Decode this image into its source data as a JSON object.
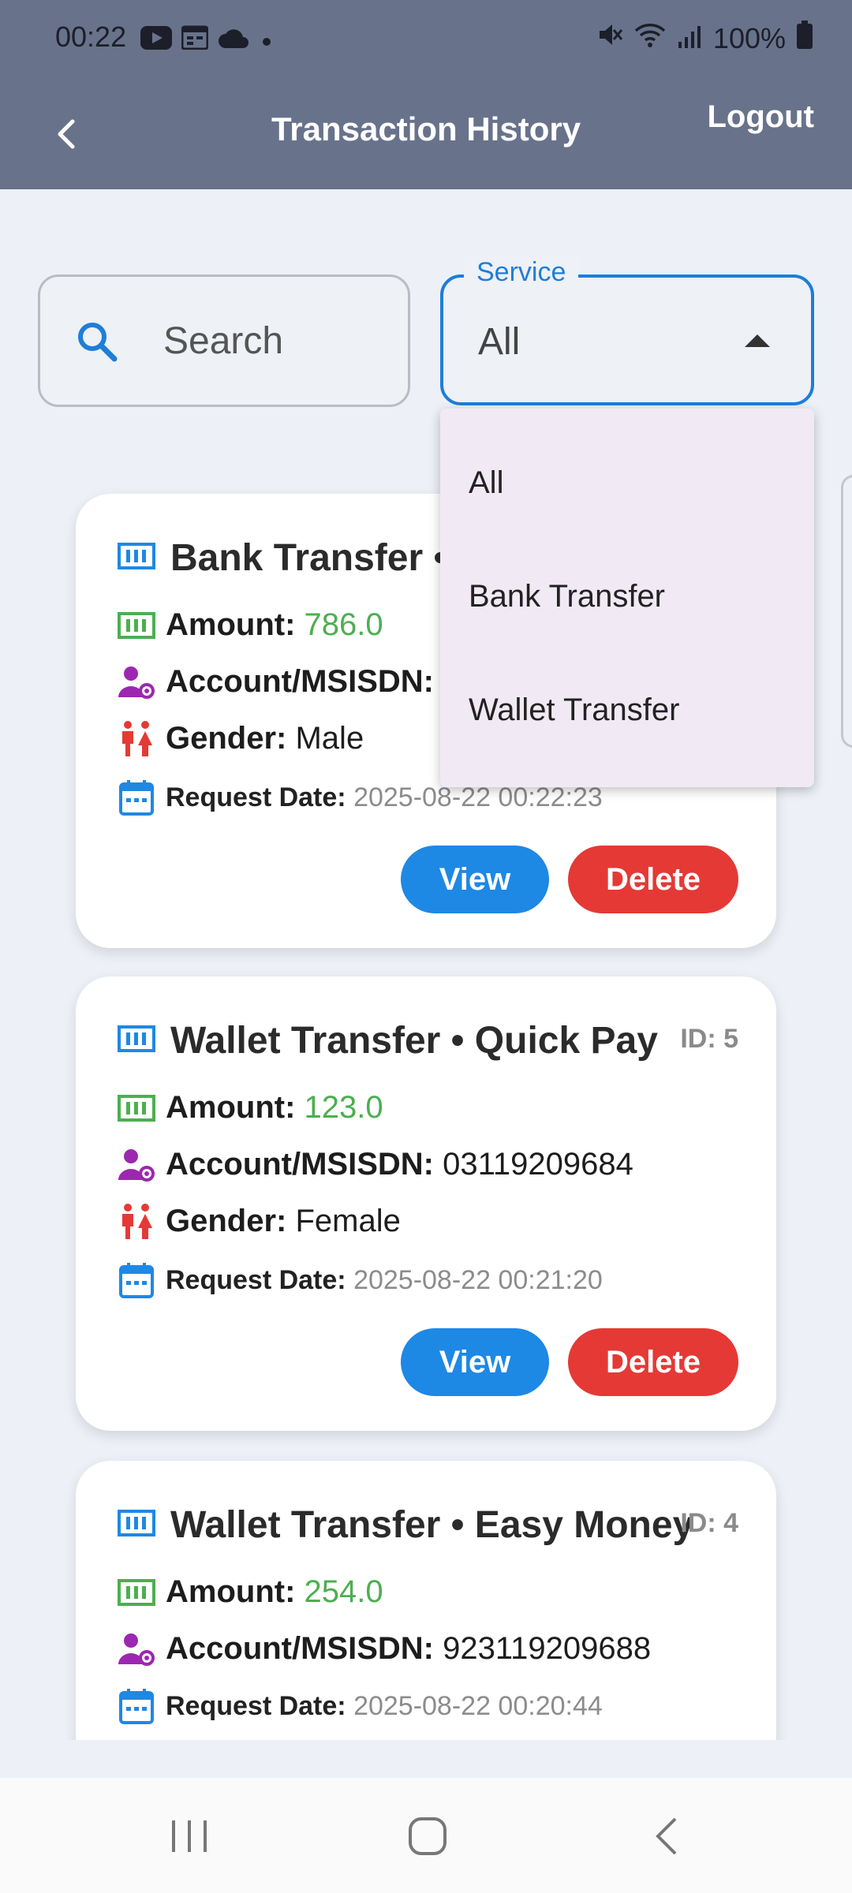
{
  "status_bar": {
    "time": "00:22",
    "battery": "100%"
  },
  "app_bar": {
    "title": "Transaction History",
    "logout_label": "Logout"
  },
  "search": {
    "placeholder": "Search"
  },
  "service_filter": {
    "label": "Service",
    "value": "All",
    "options": [
      "All",
      "Bank Transfer",
      "Wallet Transfer"
    ]
  },
  "labels": {
    "amount": "Amount:",
    "account": "Account/MSISDN:",
    "gender": "Gender:",
    "request_date": "Request Date:",
    "view": "View",
    "delete": "Delete"
  },
  "transactions": [
    {
      "title": "Bank Transfer •",
      "id": "",
      "amount": "786.0",
      "account": "",
      "gender": "Male",
      "date": "2025-08-22 00:22:23"
    },
    {
      "title": "Wallet Transfer • Quick Pay",
      "id": "ID: 5",
      "amount": "123.0",
      "account": "03119209684",
      "gender": "Female",
      "date": "2025-08-22 00:21:20"
    },
    {
      "title": "Wallet Transfer • Easy Money",
      "id": "ID: 4",
      "amount": "254.0",
      "account": "923119209688",
      "date": "2025-08-22 00:20:44"
    }
  ],
  "colors": {
    "app_bar": "#68738b",
    "accent": "#1e88e5",
    "danger": "#e53935",
    "amount": "#4caf50"
  }
}
